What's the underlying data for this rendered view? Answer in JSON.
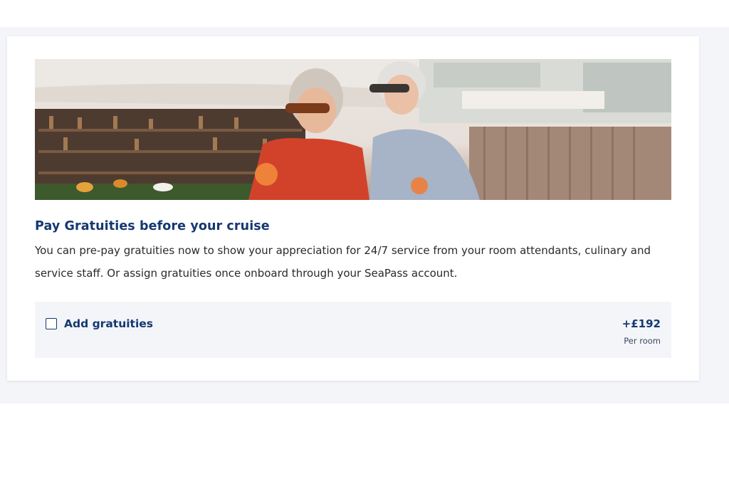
{
  "gratuities": {
    "title": "Pay Gratuities before your cruise",
    "description": "You can pre-pay gratuities now to show your appreciation for 24/7 service from your room attendants, culinary and service staff. Or assign gratuities once onboard through your SeaPass account.",
    "checkbox_label": "Add gratuities",
    "checkbox_checked": false,
    "price": "+£192",
    "price_unit": "Per room"
  },
  "colors": {
    "heading": "#15386f",
    "band": "#f3f5f9"
  },
  "icons": {
    "checkbox": "checkbox-unchecked-icon"
  }
}
